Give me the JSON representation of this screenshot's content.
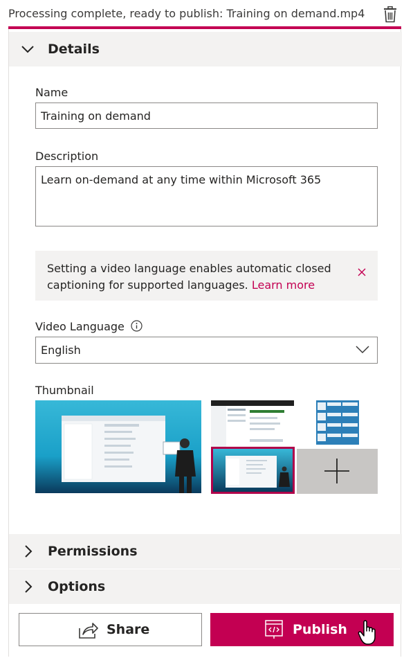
{
  "status": {
    "text": "Processing complete, ready to publish: Training on demand.mp4",
    "accent": "#c30052"
  },
  "details": {
    "title": "Details",
    "name_label": "Name",
    "name_value": "Training on demand",
    "description_label": "Description",
    "description_value": "Learn on-demand at any time within Microsoft 365",
    "info_message": "Setting a video language enables automatic closed captioning for supported languages.",
    "info_link": "Learn more",
    "language_label": "Video Language",
    "language_value": "English",
    "thumbnail_label": "Thumbnail"
  },
  "sections": {
    "permissions": "Permissions",
    "options": "Options"
  },
  "actions": {
    "share_label": "Share",
    "publish_label": "Publish"
  },
  "icons": {
    "delete": "trash-icon",
    "collapse": "chevron-down-icon",
    "expand": "chevron-right-icon",
    "info": "info-icon",
    "dismiss": "close-icon",
    "dropdown": "chevron-down-icon",
    "add": "plus-icon",
    "share": "share-icon",
    "publish": "embed-code-icon",
    "cursor": "hand-pointer-icon"
  }
}
